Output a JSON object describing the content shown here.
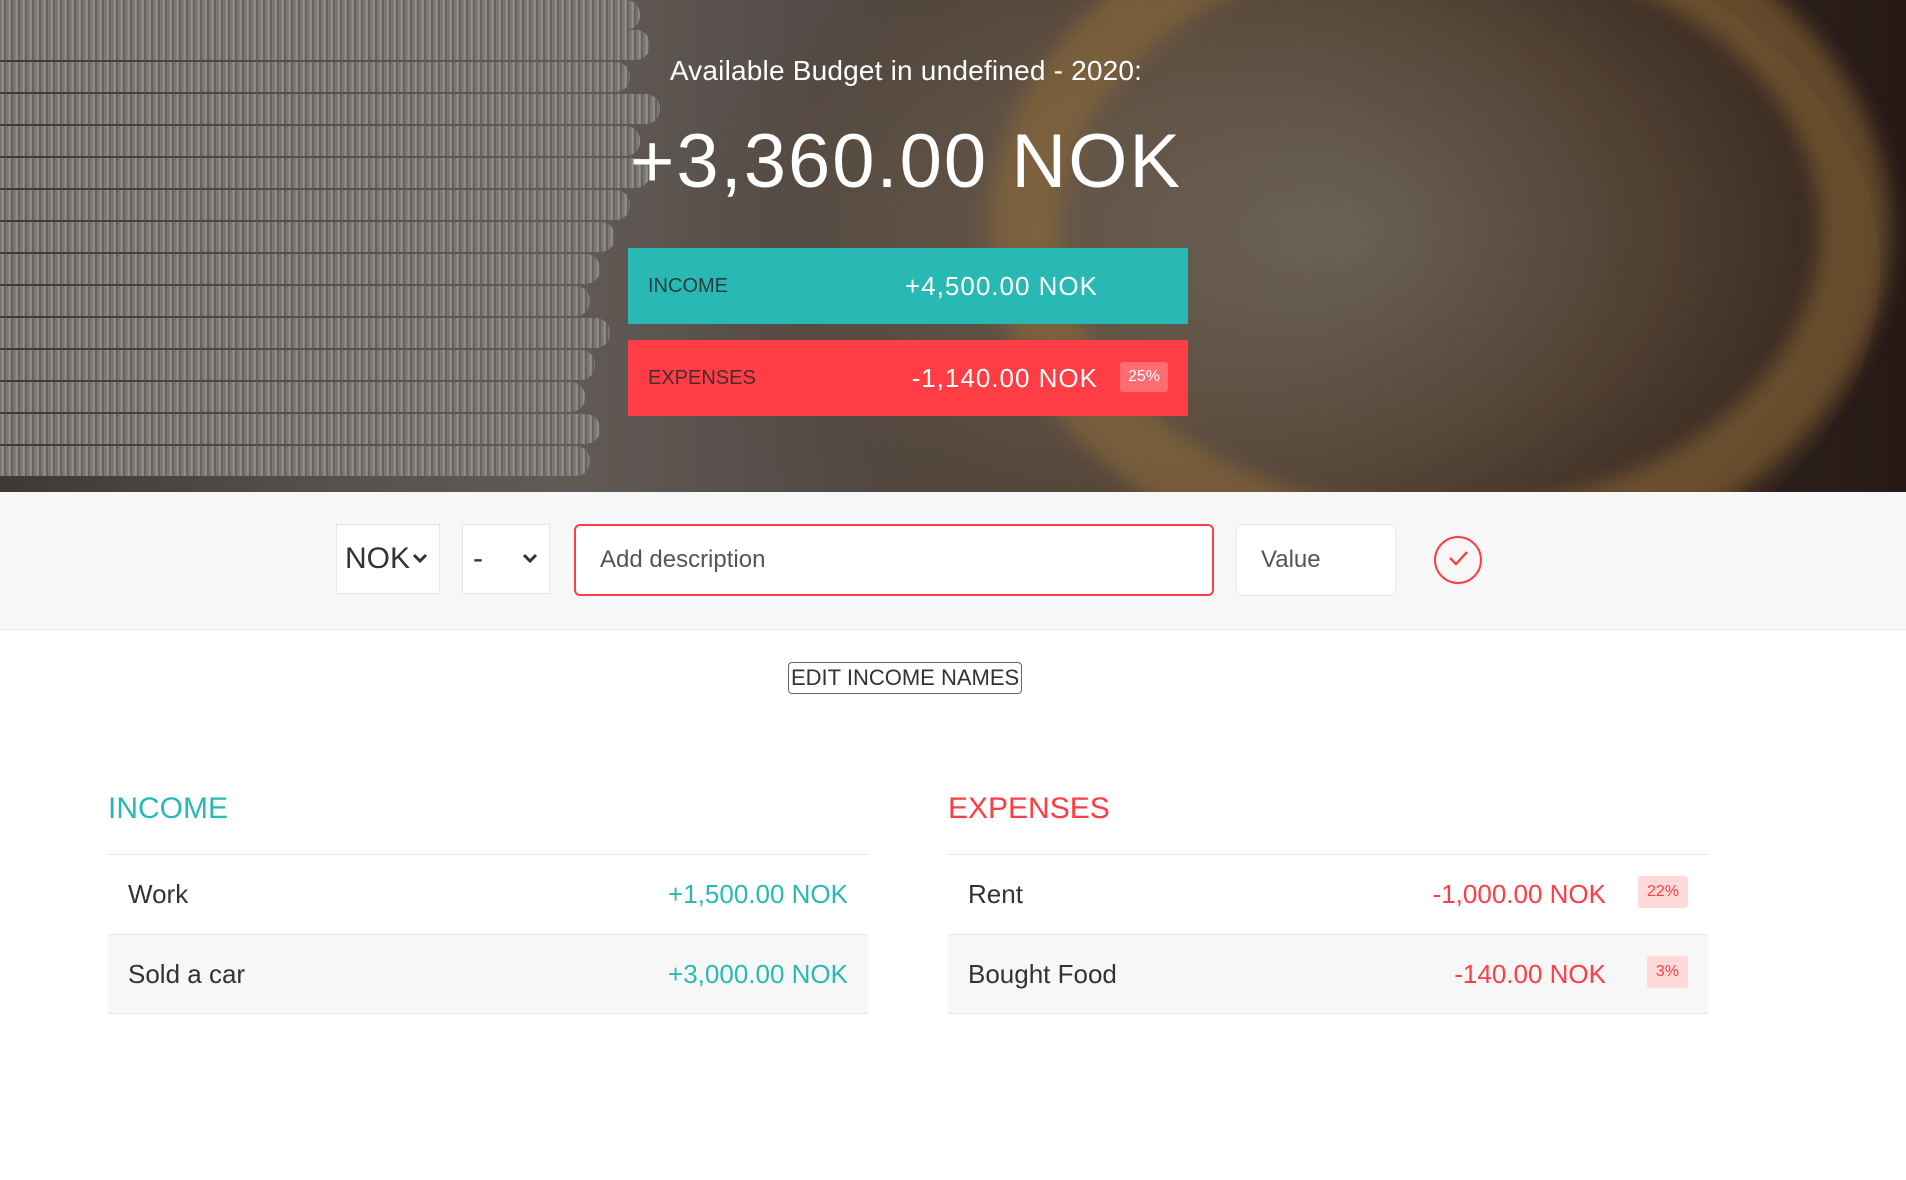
{
  "header": {
    "title": "Available Budget in undefined - 2020:",
    "budget_value": "+3,360.00 NOK",
    "income": {
      "label": "Income",
      "value": "+4,500.00 NOK"
    },
    "expenses": {
      "label": "Expenses",
      "value": "-1,140.00 NOK",
      "percentage": "25%"
    }
  },
  "add_form": {
    "currency_selected": "NOK",
    "type_selected": "-",
    "description_placeholder": "Add description",
    "value_placeholder": "Value",
    "submit_icon": "checkmark-circle-icon"
  },
  "edit_button_label": "EDIT INCOME NAMES",
  "income_list": {
    "title": "Income",
    "items": [
      {
        "description": "Work",
        "value": "+1,500.00 NOK"
      },
      {
        "description": "Sold a car",
        "value": "+3,000.00 NOK"
      }
    ]
  },
  "expenses_list": {
    "title": "Expenses",
    "items": [
      {
        "description": "Rent",
        "value": "-1,000.00 NOK",
        "percentage": "22%"
      },
      {
        "description": "Bought Food",
        "value": "-140.00 NOK",
        "percentage": "3%"
      }
    ]
  },
  "colors": {
    "income": "#28b9b5",
    "expenses": "#ff3d44",
    "background": "#ffffff",
    "add_bar": "#f7f7f7"
  }
}
